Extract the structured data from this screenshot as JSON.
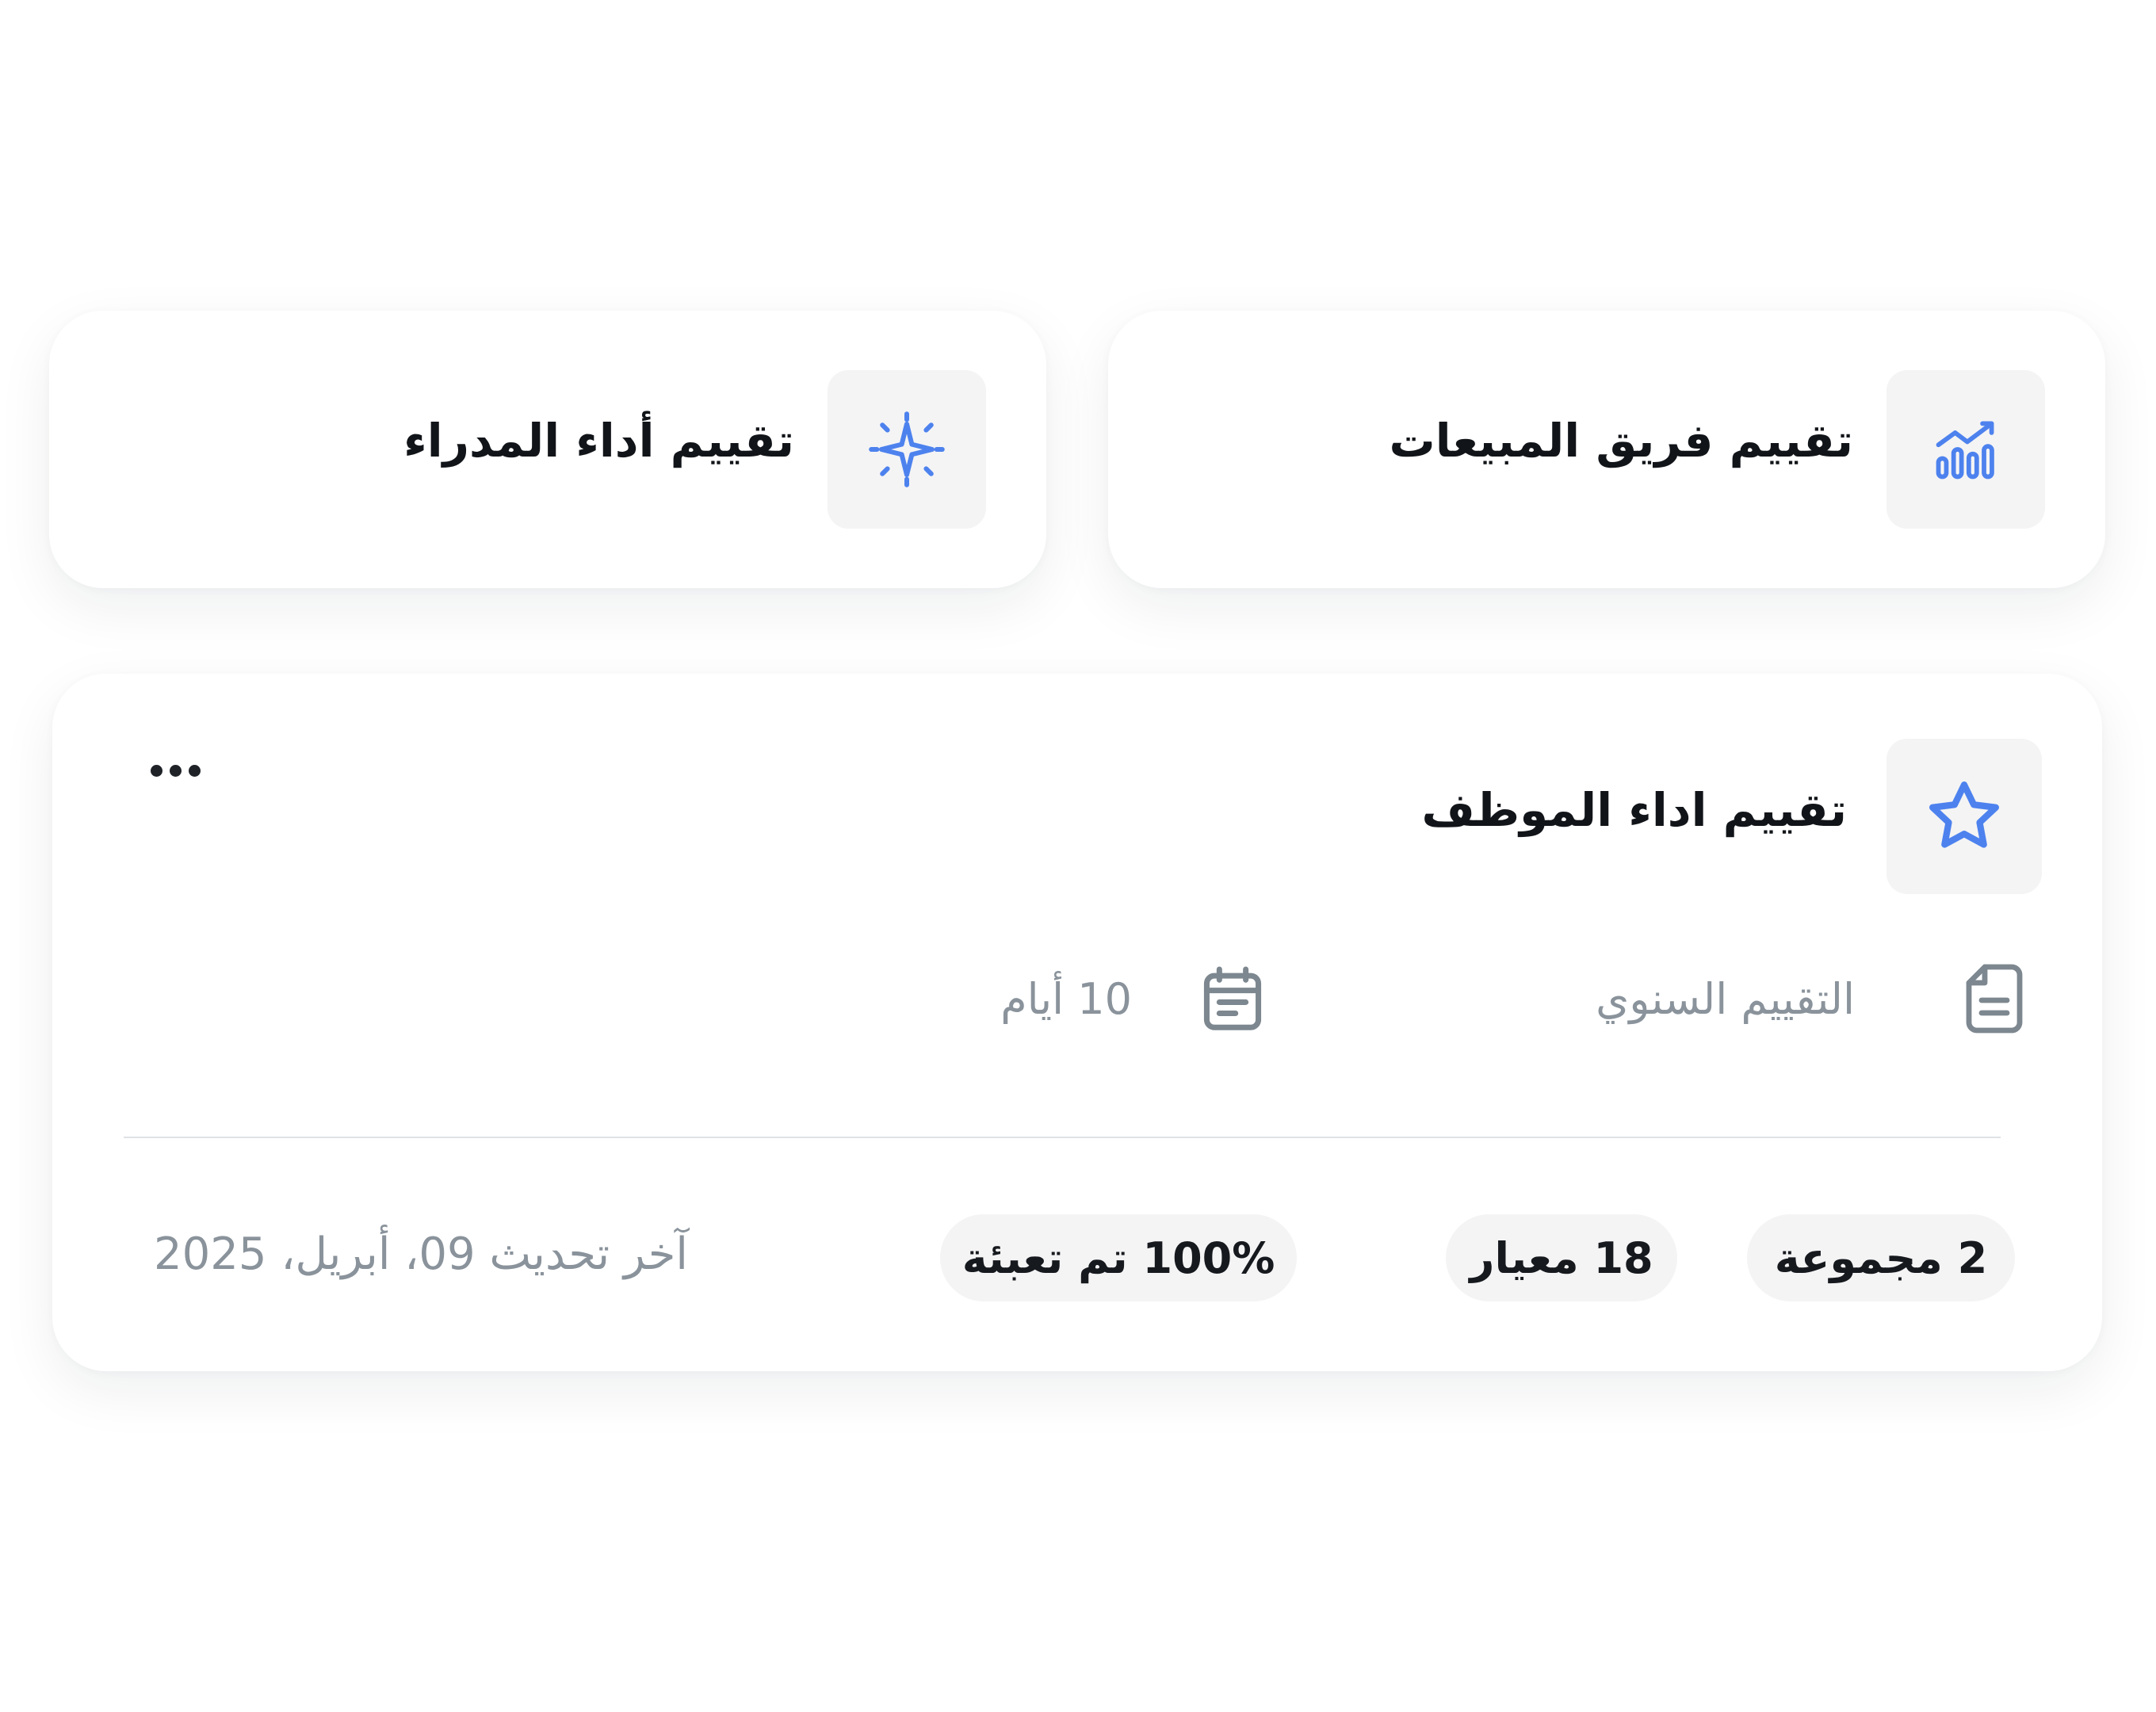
{
  "cards": {
    "sales": {
      "title": "تقييم فريق المبيعات",
      "icon": "bar-chart-trend-icon"
    },
    "managers": {
      "title": "تقييم أداء المدراء",
      "icon": "sparkle-icon"
    }
  },
  "main_card": {
    "title": "تقييم اداء الموظف",
    "icon": "star-icon",
    "type_label": "التقييم السنوي",
    "type_icon": "document-icon",
    "duration_label": "10 أيام",
    "duration_icon": "calendar-icon",
    "chips": {
      "groups": "2 مجموعة",
      "criteria": "18 معيار",
      "filled": "100% تم تعبئة"
    },
    "last_updated": "آخر تحديث 09، أبريل، 2025"
  },
  "colors": {
    "accent": "#4d82ee",
    "muted_text": "#8a939b",
    "icon_box": "#f4f4f5",
    "meta_icon": "#7d878f"
  }
}
